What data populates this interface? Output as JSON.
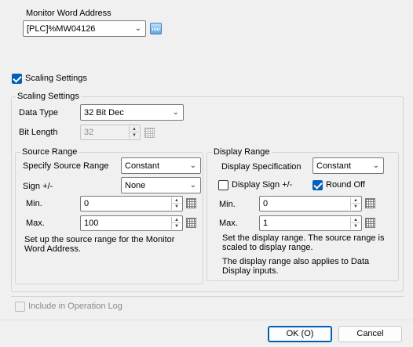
{
  "monitor": {
    "label": "Monitor Word Address",
    "address": "[PLC]%MW04126",
    "address_icon": "address-picker-icon"
  },
  "scaling": {
    "checkbox_label": "Scaling Settings",
    "checked": true,
    "group_title": "Scaling Settings",
    "data_type_label": "Data Type",
    "data_type_value": "32 Bit Dec",
    "bit_length_label": "Bit Length",
    "bit_length_value": "32"
  },
  "source_range": {
    "title": "Source Range",
    "specify_label": "Specify Source Range",
    "specify_value": "Constant",
    "sign_label": "Sign +/-",
    "sign_value": "None",
    "min_label": "Min.",
    "min_value": "0",
    "max_label": "Max.",
    "max_value": "100",
    "description": "Set up the source range for the Monitor Word Address."
  },
  "display_range": {
    "title": "Display Range",
    "spec_label": "Display Specification",
    "spec_value": "Constant",
    "display_sign_label": "Display Sign +/-",
    "display_sign_checked": false,
    "round_off_label": "Round Off",
    "round_off_checked": true,
    "min_label": "Min.",
    "min_value": "0",
    "max_label": "Max.",
    "max_value": "1",
    "description_1": "Set the display range. The source range is scaled to display range.",
    "description_2": "The display range also applies to Data Display inputs."
  },
  "operation_log": {
    "label": "Include in Operation Log",
    "checked": false
  },
  "buttons": {
    "ok": "OK (O)",
    "cancel": "Cancel"
  },
  "colors": {
    "accent": "#005fb8",
    "background": "#f0f0f0"
  }
}
